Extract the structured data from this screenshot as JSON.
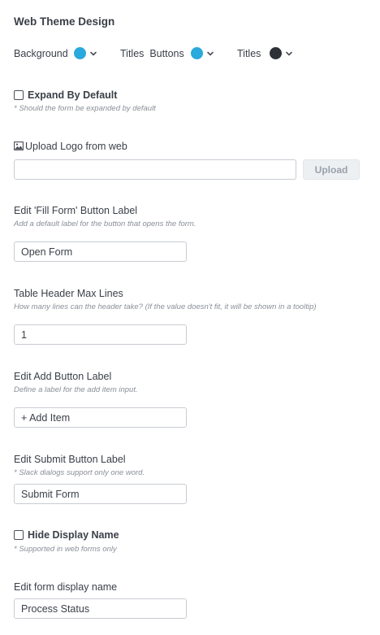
{
  "header": {
    "title": "Web Theme Design"
  },
  "theme": {
    "background_label": "Background",
    "background_color": "#29a9dc",
    "titles_buttons_label": "Titles  Buttons",
    "titles_buttons_color": "#29a9dc",
    "titles_label": "Titles",
    "titles_color": "#2e3238"
  },
  "expand": {
    "label": "Expand By Default",
    "hint": "* Should the form be expanded by default",
    "checked": false
  },
  "upload_logo": {
    "label": "Upload Logo from web",
    "value": "",
    "button": "Upload"
  },
  "fill_form": {
    "label": "Edit 'Fill Form' Button Label",
    "hint": "Add a default label for the button that opens the form.",
    "value": "Open Form"
  },
  "header_lines": {
    "label": "Table Header Max Lines",
    "hint": "How many lines can the header take? (If the value doesn't fit, it will be shown in a tooltip)",
    "value": "1"
  },
  "add_button": {
    "label": "Edit Add Button Label",
    "hint": "Define a label for the add item input.",
    "value": "+ Add Item"
  },
  "submit_button": {
    "label": "Edit Submit Button Label",
    "hint": "* Slack dialogs support only one word.",
    "value": "Submit Form"
  },
  "hide_display": {
    "label": "Hide Display Name",
    "hint": "* Supported in web forms only",
    "checked": false
  },
  "display_name": {
    "label": "Edit form display name",
    "value": "Process Status"
  }
}
